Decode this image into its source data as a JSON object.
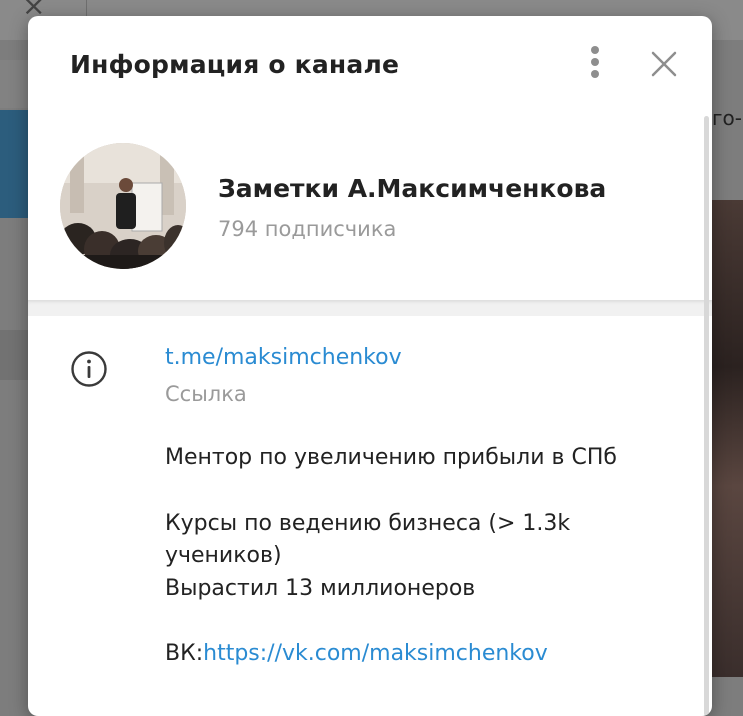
{
  "modal": {
    "title": "Информация о канале",
    "menu_icon": "more-vertical-icon",
    "close_icon": "close-icon"
  },
  "channel": {
    "name": "Заметки А.Максимченкова",
    "subscribers": "794 подписчика"
  },
  "info": {
    "icon": "info-icon",
    "link": "t.me/maksimchenkov",
    "link_caption": "Ссылка",
    "description": {
      "line1": "Ментор по увеличению прибыли в СПб",
      "line2": "Курсы по ведению бизнеса (> 1.3k",
      "line3": "учеников)",
      "line4": "Вырастил 13 миллионеров",
      "vk_prefix": "ВК:",
      "vk_link": "https://vk.com/maksimchenkov"
    }
  },
  "background": {
    "right_fragment": "го-"
  },
  "colors": {
    "accent": "#2a8bd2",
    "secondary_text": "#9a9a9a",
    "primary_text": "#222222",
    "overlay": "#7d7d7d"
  }
}
